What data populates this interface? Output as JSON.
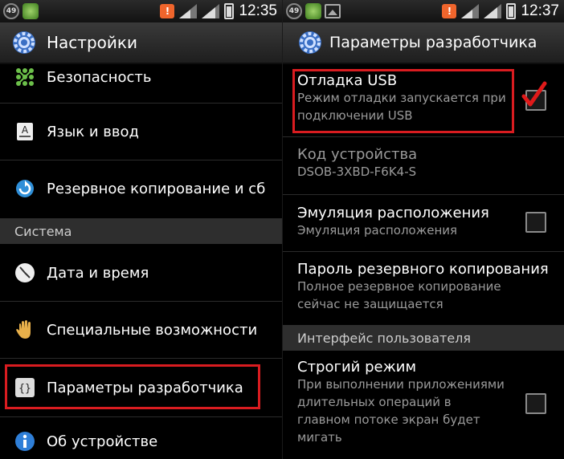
{
  "left": {
    "status": {
      "badge": "49",
      "time": "12:35"
    },
    "title": "Настройки",
    "items": [
      {
        "label": "Безопасность",
        "icon": "security-grid-icon"
      },
      {
        "label": "Язык и ввод",
        "icon": "language-icon"
      },
      {
        "label": "Резервное копирование и сб",
        "icon": "backup-icon"
      },
      {
        "label": "Дата и время",
        "icon": "clock-icon"
      },
      {
        "label": "Специальные возможности",
        "icon": "hand-icon"
      },
      {
        "label": "Параметры разработчика",
        "icon": "braces-icon"
      },
      {
        "label": "Об устройстве",
        "icon": "info-icon"
      }
    ],
    "section_system": "Система"
  },
  "right": {
    "status": {
      "badge": "49",
      "time": "12:37"
    },
    "title": "Параметры разработчика",
    "usb_debug": {
      "title": "Отладка USB",
      "summary": "Режим отладки запускается при подключении USB",
      "checked": true
    },
    "device_code": {
      "title": "Код устройства",
      "value": "DSOB-3XBD-F6K4-S"
    },
    "mock_location": {
      "title": "Эмуляция расположения",
      "summary": "Эмуляция расположения",
      "checked": false
    },
    "backup_password": {
      "title": "Пароль резервного копирования",
      "summary": "Полное резервное копирование сейчас не защищается"
    },
    "section_ui": "Интерфейс пользователя",
    "strict_mode": {
      "title": "Строгий режим",
      "summary": "При выполнении приложениями длительных операций в главном потоке экран будет мигать",
      "checked": false
    }
  },
  "colors": {
    "highlight": "#d91c20",
    "checkmark": "#e01a1a",
    "section_bg": "#2e2e2e"
  }
}
